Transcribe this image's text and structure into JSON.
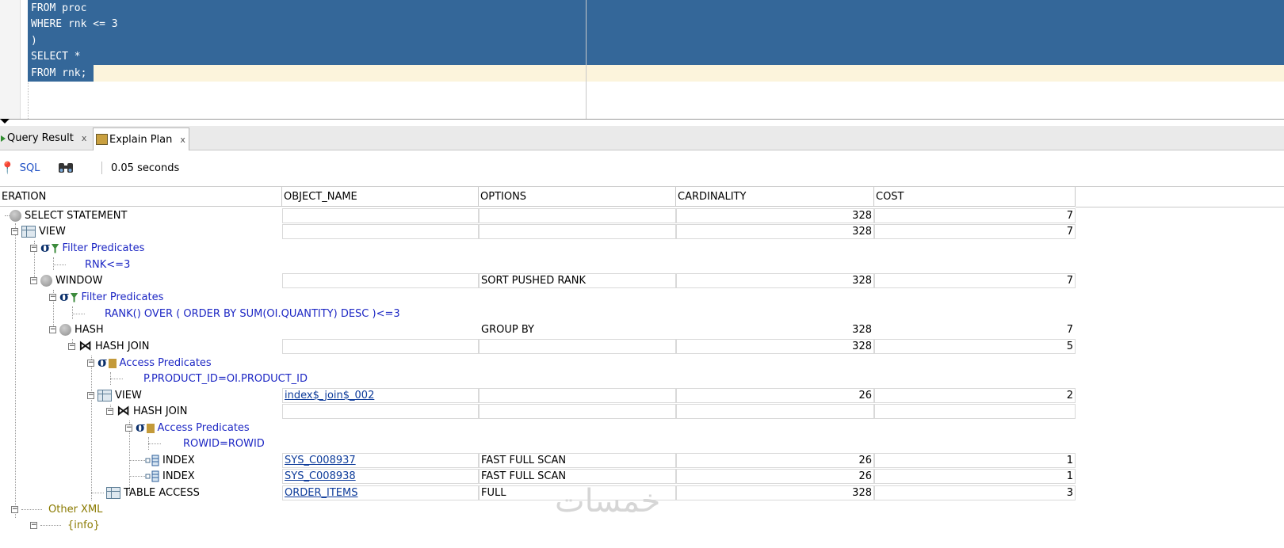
{
  "editor": {
    "lines": [
      "FROM proc",
      "WHERE rnk <= 3",
      ")",
      "SELECT *",
      "FROM rnk;"
    ]
  },
  "tabs": [
    {
      "label": "Query Result",
      "close": "x"
    },
    {
      "label": "Explain Plan",
      "close": "x"
    }
  ],
  "toolbar": {
    "sql_label": "SQL",
    "elapsed": "0.05 seconds"
  },
  "columns": [
    "ERATION",
    "OBJECT_NAME",
    "OPTIONS",
    "CARDINALITY",
    "COST"
  ],
  "rows": [
    {
      "op": "SELECT STATEMENT",
      "icon": "circle-icon",
      "card": "328",
      "cost": "7"
    },
    {
      "op": "VIEW",
      "icon": "view-icon",
      "card": "328",
      "cost": "7"
    },
    {
      "op": "Filter Predicates",
      "icon": "filter-predicate-icon"
    },
    {
      "op": "RNK<=3"
    },
    {
      "op": "WINDOW",
      "icon": "circle-icon",
      "options": "SORT PUSHED RANK",
      "card": "328",
      "cost": "7"
    },
    {
      "op": "Filter Predicates",
      "icon": "filter-predicate-icon"
    },
    {
      "op": "RANK() OVER ( ORDER BY SUM(OI.QUANTITY) DESC )<=3"
    },
    {
      "op": "HASH",
      "icon": "circle-icon",
      "options": "GROUP BY",
      "card": "328",
      "cost": "7"
    },
    {
      "op": "HASH JOIN",
      "icon": "join-icon",
      "card": "328",
      "cost": "5"
    },
    {
      "op": "Access Predicates",
      "icon": "access-predicate-icon"
    },
    {
      "op": "P.PRODUCT_ID=OI.PRODUCT_ID"
    },
    {
      "op": "VIEW",
      "icon": "view-icon",
      "object": "index$_join$_002",
      "card": "26",
      "cost": "2"
    },
    {
      "op": "HASH JOIN",
      "icon": "join-icon"
    },
    {
      "op": "Access Predicates",
      "icon": "access-predicate-icon"
    },
    {
      "op": "ROWID=ROWID"
    },
    {
      "op": "INDEX",
      "icon": "index-icon",
      "object": "SYS_C008937",
      "options": "FAST FULL SCAN",
      "card": "26",
      "cost": "1"
    },
    {
      "op": "INDEX",
      "icon": "index-icon",
      "object": "SYS_C008938",
      "options": "FAST FULL SCAN",
      "card": "26",
      "cost": "1"
    },
    {
      "op": "TABLE ACCESS",
      "icon": "view-icon",
      "object": "ORDER_ITEMS",
      "options": "FULL",
      "card": "328",
      "cost": "3"
    },
    {
      "op": "Other XML"
    },
    {
      "op": "{info}"
    }
  ],
  "watermark": "خمسات",
  "colors": {
    "selection": "#346799",
    "current_line": "#fcf4dc",
    "predicate_text": "#1d27c4",
    "xml_text": "#8a7a00",
    "link": "#0d3b9a"
  }
}
